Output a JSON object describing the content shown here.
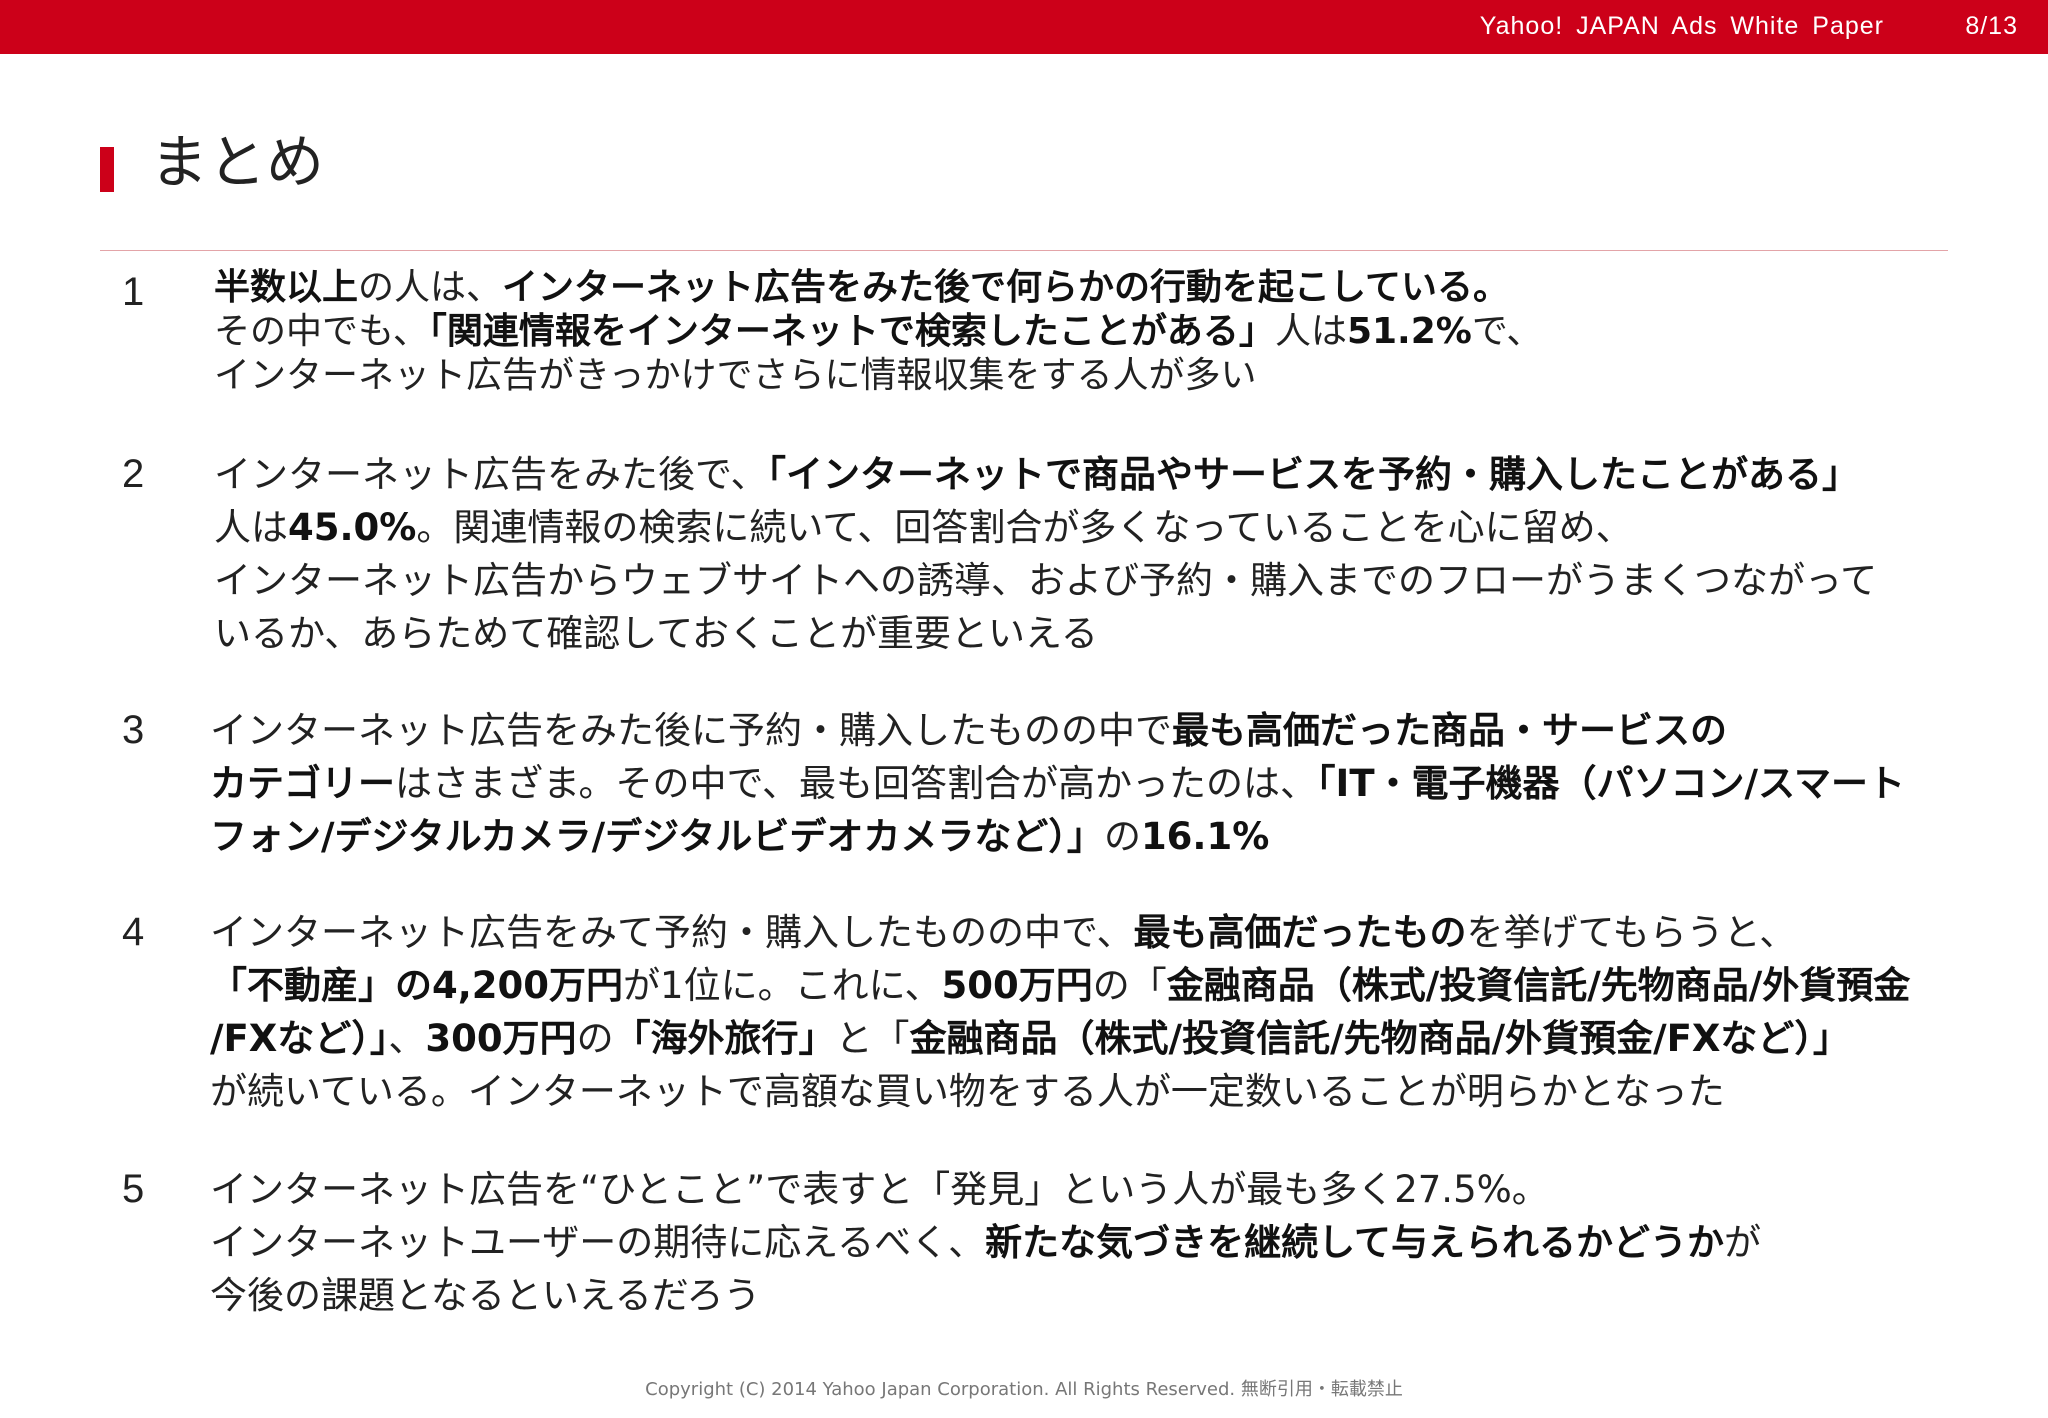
{
  "header": {
    "brand": "Yahoo! JAPAN Ads White Paper",
    "page": "8/13",
    "bar_color": "#cc0019"
  },
  "title": "まとめ",
  "items": [
    {
      "number": "1",
      "lines": [
        [
          {
            "t": "半数以上",
            "b": true
          },
          {
            "t": "の人は、",
            "b": false
          },
          {
            "t": "インターネット広告をみた後で何らかの行動を起こしている。",
            "b": true
          }
        ],
        [
          {
            "t": "その中でも、",
            "b": false
          },
          {
            "t": "「関連情報をインターネットで検索したことがある」",
            "b": true
          },
          {
            "t": "人は",
            "b": false
          },
          {
            "t": "51.2%",
            "b": true
          },
          {
            "t": "で、",
            "b": false
          }
        ],
        [
          {
            "t": "インターネット広告がきっかけでさらに情報収集をする人が多い",
            "b": false
          }
        ]
      ]
    },
    {
      "number": "2",
      "lines": [
        [
          {
            "t": "インターネット広告をみた後で、",
            "b": false
          },
          {
            "t": "「インターネットで商品やサービスを予約・購入したことがある」",
            "b": true
          }
        ],
        [
          {
            "t": "人は",
            "b": false
          },
          {
            "t": "45.0%",
            "b": true
          },
          {
            "t": "。関連情報の検索に続いて、回答割合が多くなっていることを心に留め、",
            "b": false
          }
        ],
        [
          {
            "t": "インターネット広告からウェブサイトへの誘導、および予約・購入までのフローがうまくつながって",
            "b": false
          }
        ],
        [
          {
            "t": "いるか、あらためて確認しておくことが重要といえる",
            "b": false
          }
        ]
      ]
    },
    {
      "number": "3",
      "lines": [
        [
          {
            "t": "インターネット広告をみた後に予約・購入したものの中で",
            "b": false
          },
          {
            "t": "最も高価だった商品・サービスの",
            "b": true
          }
        ],
        [
          {
            "t": "カテゴリー",
            "b": true
          },
          {
            "t": "はさまざま。その中で、最も回答割合が高かったのは、",
            "b": false
          },
          {
            "t": "「IT・電子機器（パソコン/スマート",
            "b": true
          }
        ],
        [
          {
            "t": "フォン/デジタルカメラ/デジタルビデオカメラなど）」",
            "b": true
          },
          {
            "t": "の",
            "b": false
          },
          {
            "t": "16.1%",
            "b": true
          }
        ]
      ]
    },
    {
      "number": "4",
      "lines": [
        [
          {
            "t": "インターネット広告をみて予約・購入したものの中で、",
            "b": false
          },
          {
            "t": "最も高価だったもの",
            "b": true
          },
          {
            "t": "を挙げてもらうと、",
            "b": false
          }
        ],
        [
          {
            "t": "「不動産」の4,200万円",
            "b": true
          },
          {
            "t": "が1位に。これに、",
            "b": false
          },
          {
            "t": "500万円",
            "b": true
          },
          {
            "t": "の「",
            "b": false
          },
          {
            "t": "金融商品（株式/投資信託/先物商品/外貨預金",
            "b": true
          }
        ],
        [
          {
            "t": "/FXなど）」",
            "b": true
          },
          {
            "t": "、",
            "b": false
          },
          {
            "t": "300万円",
            "b": true
          },
          {
            "t": "の",
            "b": false
          },
          {
            "t": "「海外旅行」",
            "b": true
          },
          {
            "t": "と「",
            "b": false
          },
          {
            "t": "金融商品（株式/投資信託/先物商品/外貨預金/FXなど）」",
            "b": true
          }
        ],
        [
          {
            "t": "が続いている。インターネットで高額な買い物をする人が一定数いることが明らかとなった",
            "b": false
          }
        ]
      ]
    },
    {
      "number": "5",
      "lines": [
        [
          {
            "t": "インターネット広告を“ひとこと”で表すと「発見」という人が最も多く27.5%。",
            "b": false
          }
        ],
        [
          {
            "t": "インターネットユーザーの期待に応えるべく、",
            "b": false
          },
          {
            "t": "新たな気づきを継続して与えられるかどうか",
            "b": true
          },
          {
            "t": "が",
            "b": false
          }
        ],
        [
          {
            "t": "今後の課題となるといえるだろう",
            "b": false
          }
        ]
      ]
    }
  ],
  "footer": "Copyright (C) 2014 Yahoo Japan Corporation. All Rights Reserved. 無断引用・転載禁止"
}
